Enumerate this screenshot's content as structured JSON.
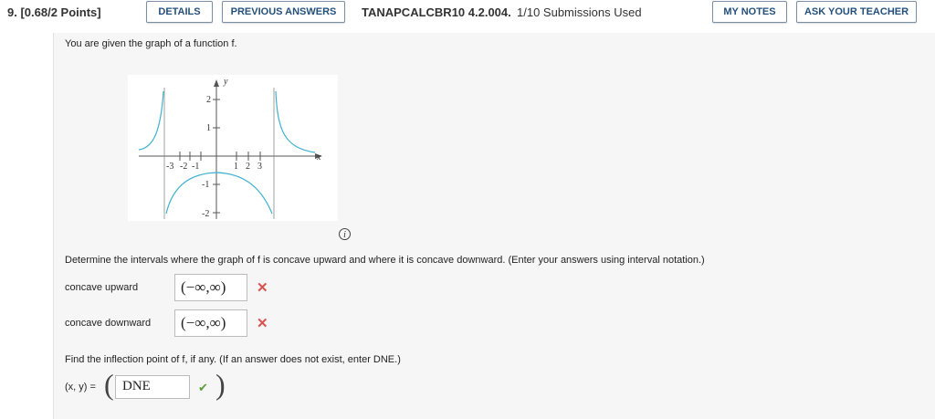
{
  "header": {
    "question_number": "9. [0.68/2 Points]",
    "details_label": "DETAILS",
    "previous_answers_label": "PREVIOUS ANSWERS",
    "question_code": "TANAPCALCBR10 4.2.004.",
    "submissions": "1/10 Submissions Used",
    "my_notes_label": "MY NOTES",
    "ask_teacher_label": "ASK YOUR TEACHER"
  },
  "prompt": "You are given the graph of a function f.",
  "graph": {
    "x_axis_label": "x",
    "y_axis_label": "y",
    "x_ticks": [
      "-3",
      "-2",
      "-1",
      "1",
      "2",
      "3"
    ],
    "y_ticks": [
      "2",
      "1",
      "-1",
      "-2"
    ],
    "curve_color": "#3fb1d0",
    "info_icon": "info-icon"
  },
  "instructions": "Determine the intervals where the graph of f is concave upward and where it is concave downward. (Enter your answers using interval notation.)",
  "concave_up": {
    "label": "concave upward",
    "value": "(−∞,∞)",
    "status": "incorrect"
  },
  "concave_down": {
    "label": "concave downward",
    "value": "(−∞,∞)",
    "status": "incorrect"
  },
  "inflection": {
    "question": "Find the inflection point of f, if any. (If an answer does not exist, enter DNE.)",
    "label": "(x, y) =",
    "value": "DNE",
    "status": "correct"
  },
  "colors": {
    "accent": "#25507a",
    "incorrect": "#d9534f",
    "correct": "#5a9e3c"
  }
}
